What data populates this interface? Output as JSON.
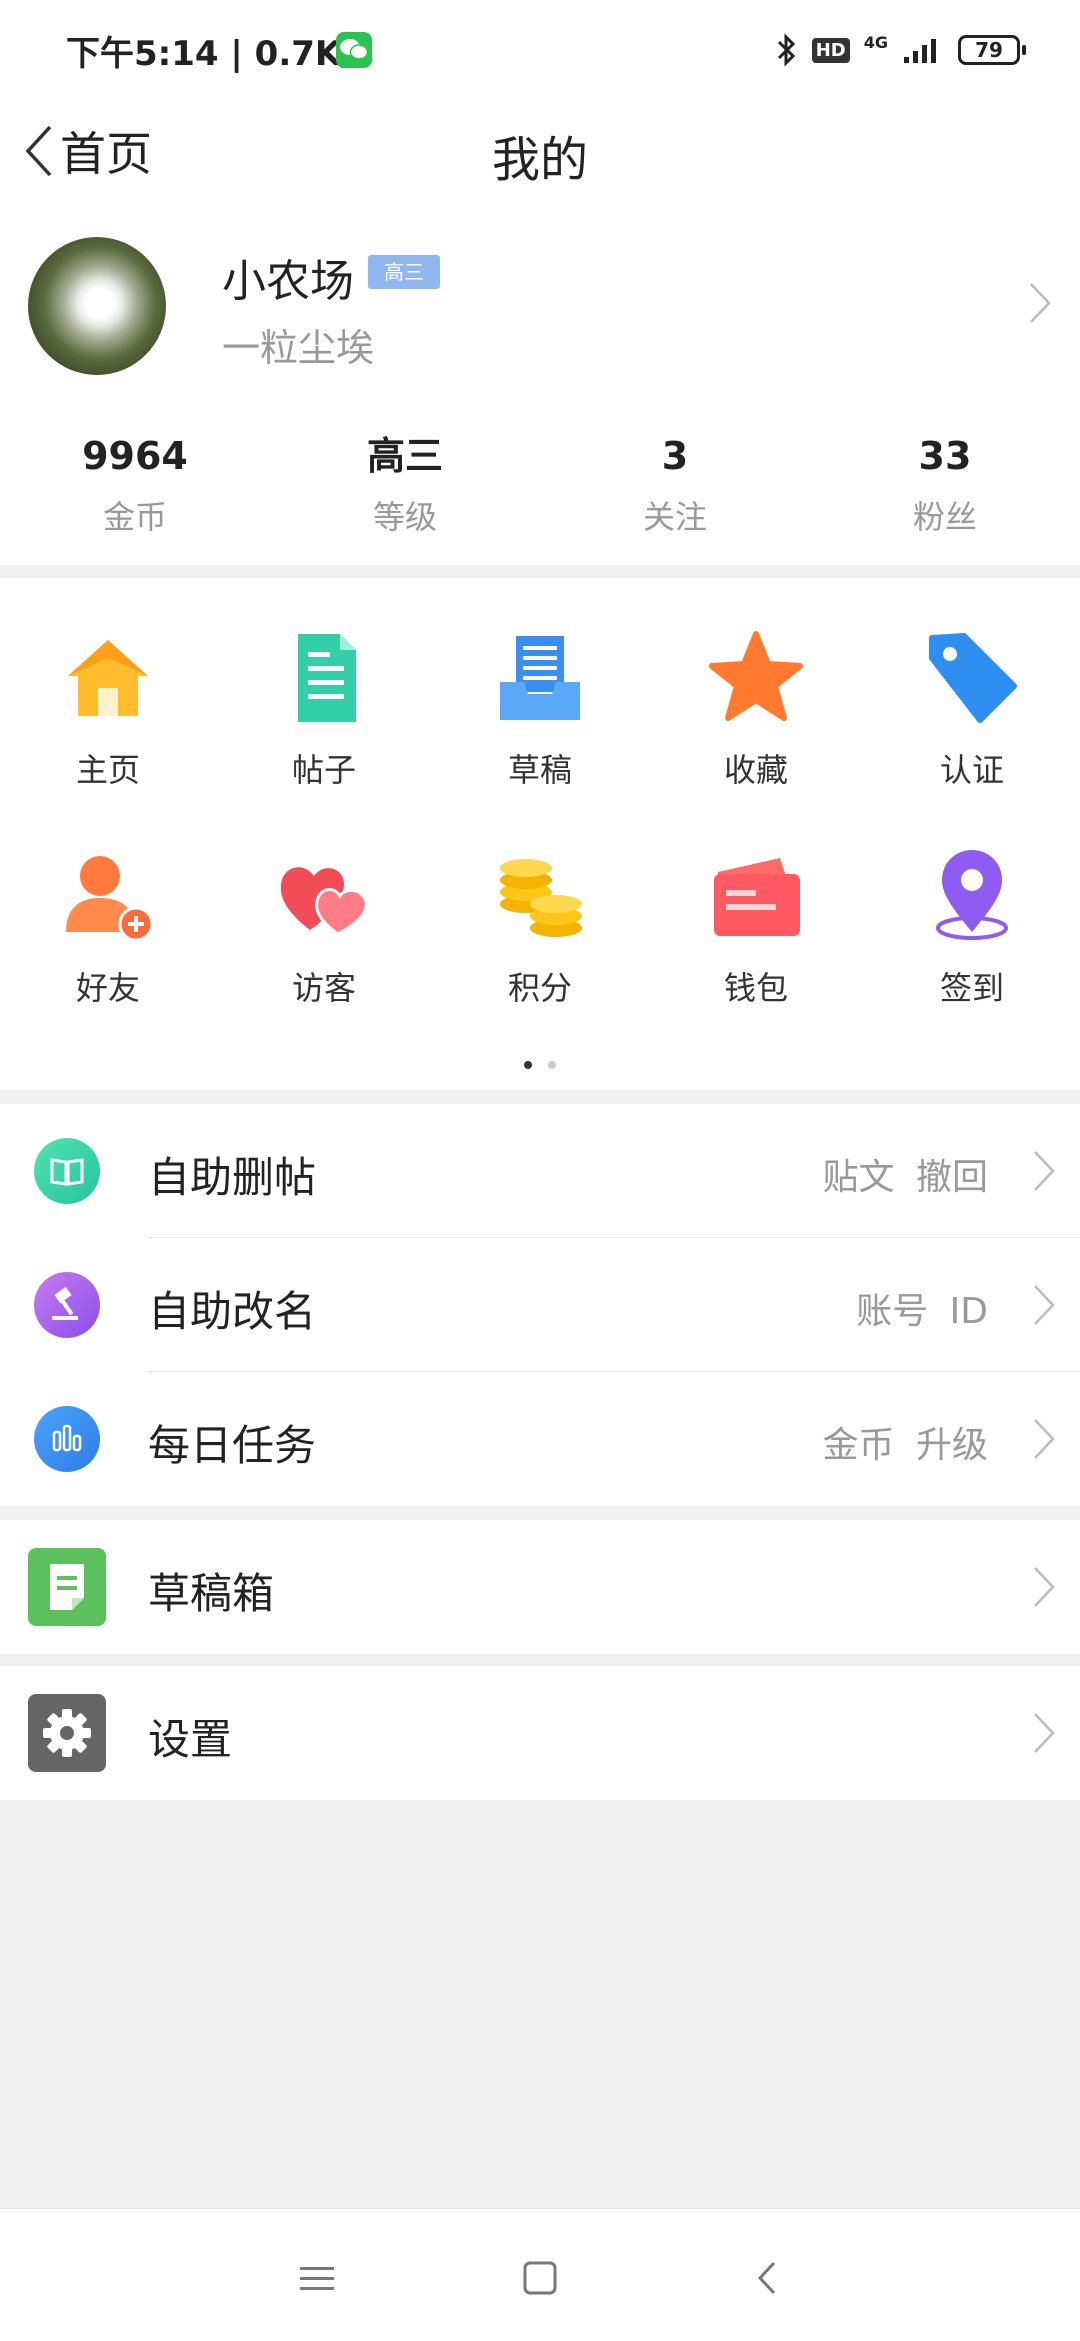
{
  "status_bar": {
    "time_speed": "下午5:14 | 0.7K/s",
    "hd": "HD",
    "network": "4G",
    "battery": "79"
  },
  "header": {
    "back_label": "首页",
    "title": "我的"
  },
  "profile": {
    "name": "小农场",
    "level_badge": "高三",
    "subtitle": "一粒尘埃"
  },
  "stats": [
    {
      "value": "9964",
      "label": "金币"
    },
    {
      "value": "高三",
      "label": "等级"
    },
    {
      "value": "3",
      "label": "关注"
    },
    {
      "value": "33",
      "label": "粉丝"
    }
  ],
  "grid_items": [
    {
      "label": "主页",
      "icon": "home-icon"
    },
    {
      "label": "帖子",
      "icon": "document-icon"
    },
    {
      "label": "草稿",
      "icon": "draft-tray-icon"
    },
    {
      "label": "收藏",
      "icon": "star-icon"
    },
    {
      "label": "认证",
      "icon": "tag-icon"
    },
    {
      "label": "好友",
      "icon": "add-friend-icon"
    },
    {
      "label": "访客",
      "icon": "hearts-icon"
    },
    {
      "label": "积分",
      "icon": "coins-icon"
    },
    {
      "label": "钱包",
      "icon": "wallet-icon"
    },
    {
      "label": "签到",
      "icon": "location-pin-icon"
    }
  ],
  "page_indicator": {
    "pages": 2,
    "current": 1
  },
  "list_items": [
    {
      "title": "自助删帖",
      "right": "贴文 撤回",
      "icon": "book-icon",
      "color": "#2fd0a0"
    },
    {
      "title": "自助改名",
      "right": "账号 ID",
      "icon": "hammer-icon",
      "color": "#a35ee8"
    },
    {
      "title": "每日任务",
      "right": "金币 升级",
      "icon": "bar-chart-icon",
      "color": "#3f8ef2"
    }
  ],
  "drafts": {
    "title": "草稿箱",
    "icon": "note-icon",
    "color": "#5cc15c"
  },
  "settings": {
    "title": "设置",
    "icon": "gear-icon",
    "color": "#666666"
  },
  "nav_bar": [
    "menu-icon",
    "home-square-icon",
    "back-triangle-icon"
  ]
}
